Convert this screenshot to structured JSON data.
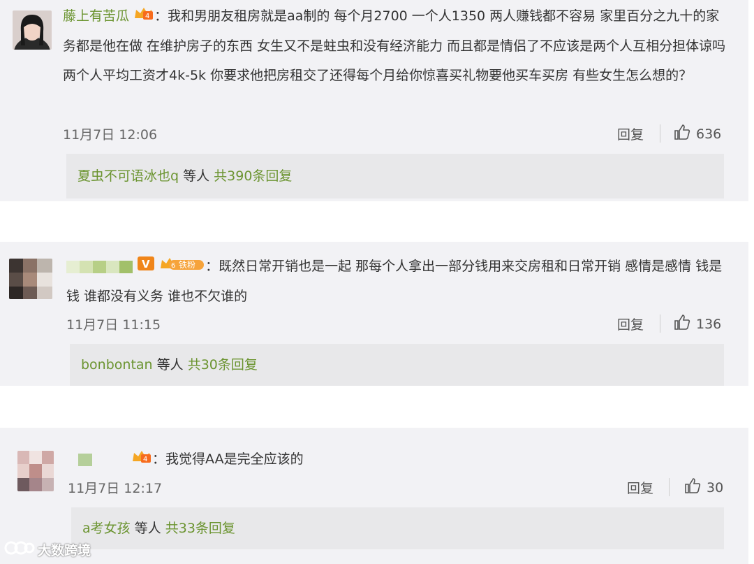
{
  "comments": [
    {
      "username": "藤上有苦瓜",
      "text": "：我和男朋友租房就是aa制的 每个月2700 一个人1350 两人赚钱都不容易 家里百分之九十的家务都是他在做 在维护房子的东西 女生又不是蛀虫和没有经济能力 而且都是情侣了不应该是两个人互相分担体谅吗 两个人平均工资才4k-5k 你要求他把房租交了还得每个月给你惊喜买礼物要他买车买房 有些女生怎么想的？",
      "time": "11月7日 12:06",
      "reply_label": "回复",
      "likes": "636",
      "sub_user": "夏虫不可语冰也q",
      "sub_mid": " 等人 ",
      "sub_count": "共390条回复"
    },
    {
      "username": "",
      "badge_text": "铁粉",
      "text": "：既然日常开销也是一起  那每个人拿出一部分钱用来交房租和日常开销  感情是感情  钱是钱  谁都没有义务  谁也不欠谁的",
      "time": "11月7日 11:15",
      "reply_label": "回复",
      "likes": "136",
      "sub_user": "bonbontan",
      "sub_mid": " 等人 ",
      "sub_count": "共30条回复"
    },
    {
      "username": "",
      "text": "：我觉得AA是完全应该的",
      "time": "11月7日 12:17",
      "reply_label": "回复",
      "likes": "30",
      "sub_user": "a考女孩",
      "sub_mid": " 等人 ",
      "sub_count": "共33条回复"
    }
  ],
  "watermark": "大数跨境",
  "icons": {
    "like": "thumbs-up-icon",
    "vip": "v-icon",
    "level": "crown-icon"
  },
  "colors": {
    "username": "#6b9430",
    "card_bg": "#f2f2f5",
    "sub_bg": "#e8e8ea"
  }
}
